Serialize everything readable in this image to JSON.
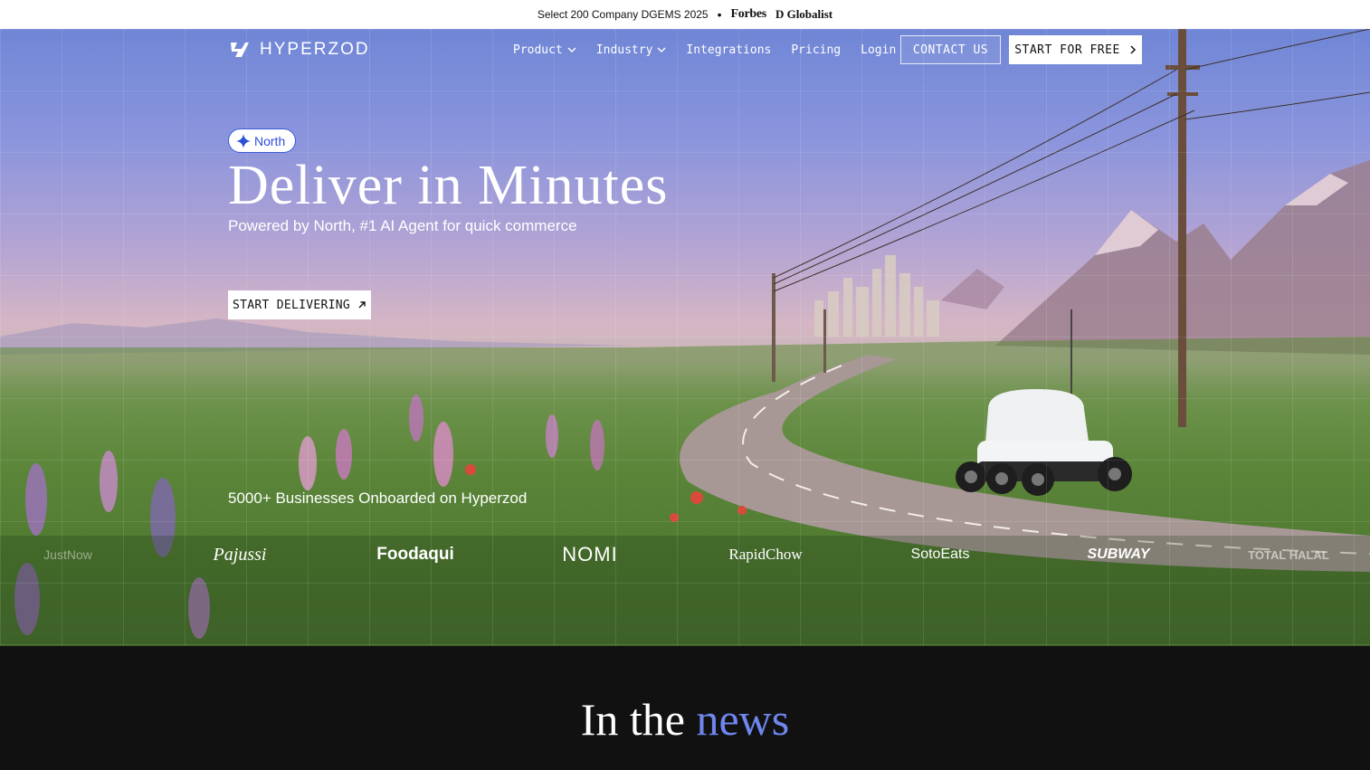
{
  "announcement": {
    "text": "Select 200 Company DGEMS 2025",
    "separator": "•",
    "press": [
      "Forbes",
      "D Globalist"
    ]
  },
  "nav": {
    "brand": "HYPERZOD",
    "links": [
      {
        "label": "Product",
        "dropdown": true
      },
      {
        "label": "Industry",
        "dropdown": true
      },
      {
        "label": "Integrations",
        "dropdown": false
      },
      {
        "label": "Pricing",
        "dropdown": false
      },
      {
        "label": "Login",
        "dropdown": false
      }
    ],
    "contact_label": "CONTACT US",
    "start_label": "START FOR FREE"
  },
  "hero": {
    "badge": "North",
    "headline": "Deliver in Minutes",
    "subheadline": "Powered by North, #1 AI Agent for quick commerce",
    "cta_label": "START DELIVERING",
    "onboarded_text": "5000+ Businesses Onboarded on Hyperzod"
  },
  "client_logos": [
    "JustNow",
    "Pajussi",
    "Foodaqui",
    "NOMI",
    "RapidChow",
    "SotoEats",
    "SUBWAY",
    "TOTAL HALAL"
  ],
  "news": {
    "title_part1": "In the",
    "title_part2": "news"
  },
  "colors": {
    "accent": "#6f86ee",
    "badge_blue": "#2b4fd6",
    "dark_bg": "#111111"
  }
}
